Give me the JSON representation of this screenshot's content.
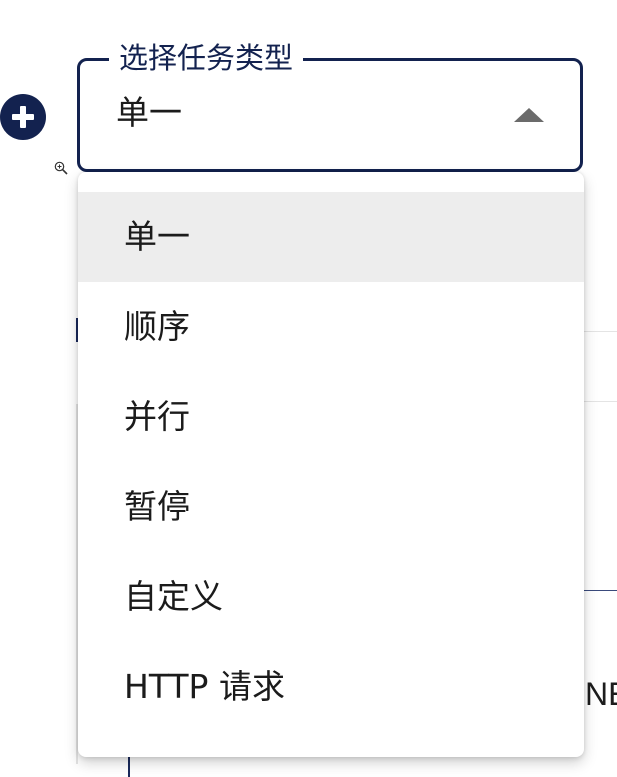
{
  "task_type_select": {
    "label": "选择任务类型",
    "value": "单一",
    "expanded": true
  },
  "menu": {
    "items": [
      {
        "label": "单一",
        "selected": true
      },
      {
        "label": "顺序",
        "selected": false
      },
      {
        "label": "并行",
        "selected": false
      },
      {
        "label": "暂停",
        "selected": false
      },
      {
        "label": "自定义",
        "selected": false
      },
      {
        "label": "HTTP 请求",
        "selected": false
      }
    ]
  },
  "background": {
    "partial_text": "NE"
  },
  "icons": {
    "add": "plus-circle-icon",
    "caret": "caret-up-icon",
    "cursor": "zoom-in-icon"
  },
  "colors": {
    "primary": "#13224f",
    "selected_bg": "#ededed",
    "text": "#1b1b1b",
    "caret": "#6b6b6b"
  }
}
